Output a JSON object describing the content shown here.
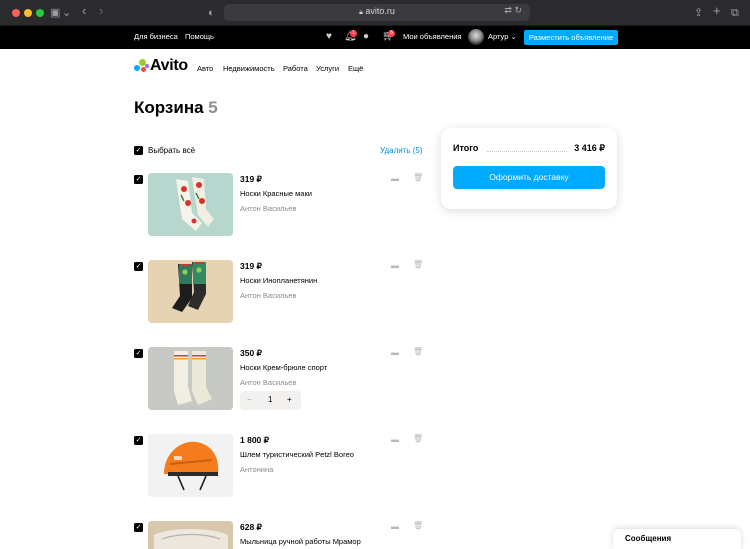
{
  "browser": {
    "url": "avito.ru"
  },
  "topbar": {
    "business_link": "Для бизнеса",
    "help_link": "Помощь",
    "notifications_badge": "1",
    "cart_badge": "5",
    "my_ads_link": "Мои объявления",
    "user_name": "Артур",
    "post_ad_button": "Разместить объявление"
  },
  "nav": {
    "logo": "Avito",
    "items": [
      {
        "label": "Авто"
      },
      {
        "label": "Недвижимость"
      },
      {
        "label": "Работа"
      },
      {
        "label": "Услуги"
      },
      {
        "label": "Ещё"
      }
    ]
  },
  "cart": {
    "title": "Корзина",
    "count": "5",
    "select_all_label": "Выбрать всё",
    "delete_all_label": "Удалить (5)",
    "items": [
      {
        "price": "319 ₽",
        "title": "Носки Красные маки",
        "seller": "Антон Васильев",
        "checked": true
      },
      {
        "price": "319 ₽",
        "title": "Носки Инопланетянин",
        "seller": "Антон Васильев",
        "checked": true
      },
      {
        "price": "350 ₽",
        "title": "Носки Крем-брюле спорт",
        "seller": "Антон Васильев",
        "checked": true,
        "quantity": "1",
        "minus": "−",
        "plus": "+"
      },
      {
        "price": "1 800 ₽",
        "title": "Шлем туристический Petzl Boreo",
        "seller": "Антонина",
        "checked": true
      },
      {
        "price": "628 ₽",
        "title": "Мыльница ручной работы Мрамор",
        "seller": "",
        "checked": true
      }
    ]
  },
  "summary": {
    "total_label": "Итого",
    "total_value": "3 416 ₽",
    "checkout_button": "Оформить доставку"
  },
  "messages_tab": {
    "label": "Сообщения"
  },
  "colors": {
    "accent": "#00aaff",
    "link": "#0092e0",
    "badge": "#ff4053"
  }
}
